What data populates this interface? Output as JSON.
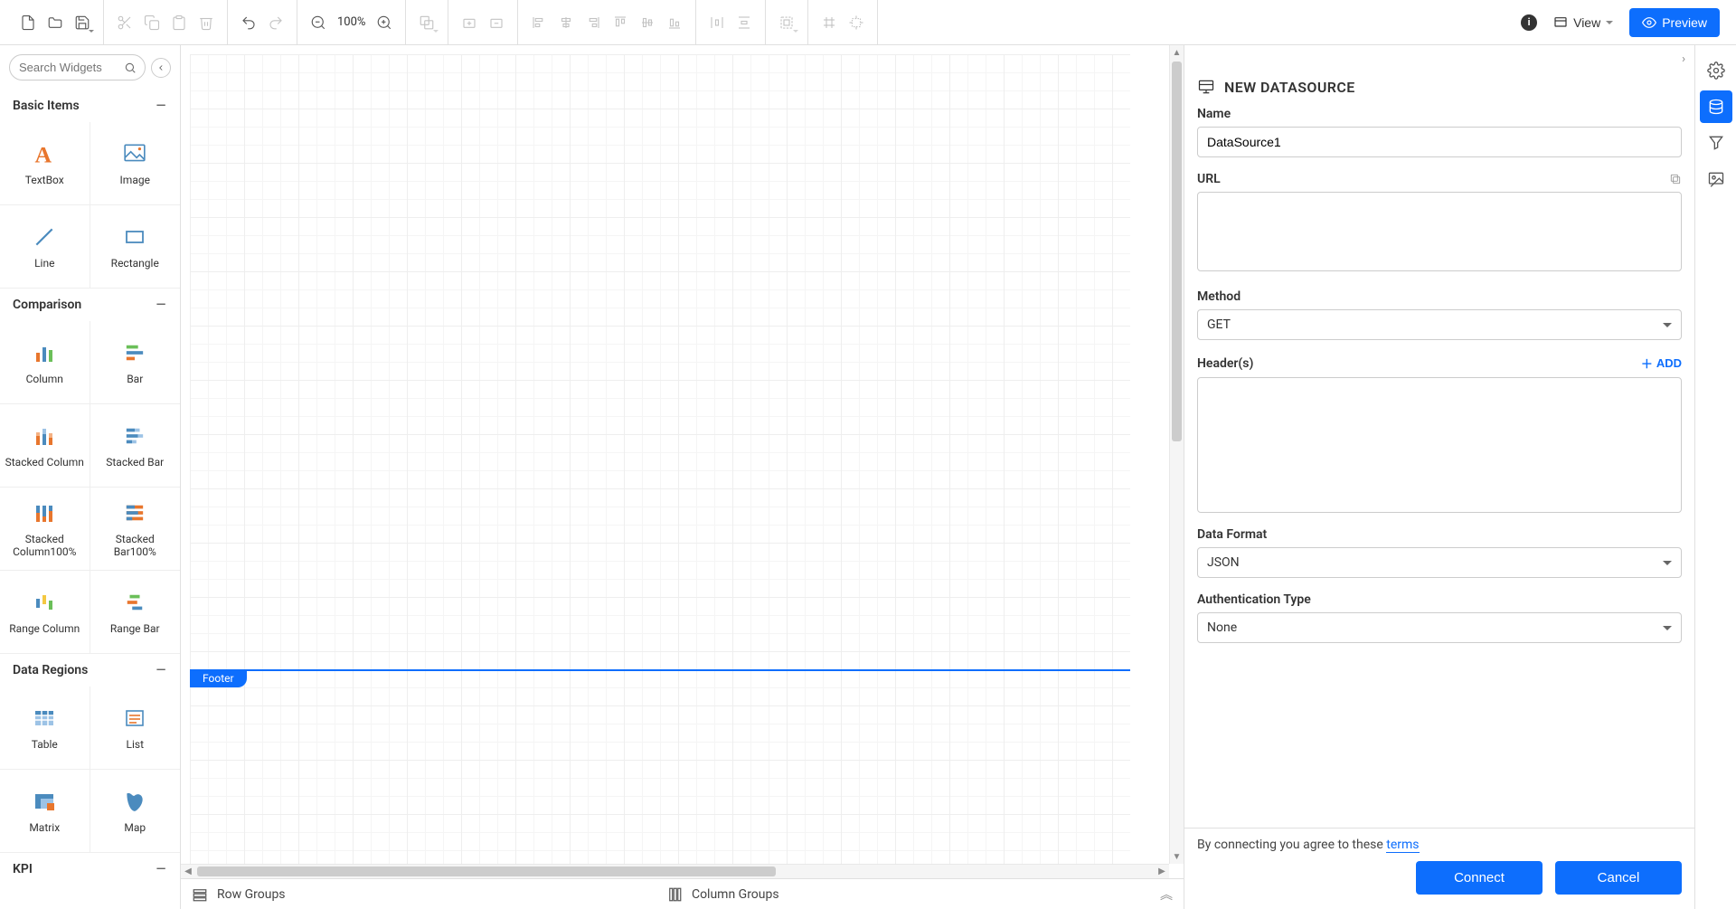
{
  "toolbar": {
    "zoom": "100%",
    "view_label": "View",
    "preview_label": "Preview"
  },
  "search": {
    "placeholder": "Search Widgets"
  },
  "sections": {
    "basic": {
      "title": "Basic Items",
      "items": [
        "TextBox",
        "Image",
        "Line",
        "Rectangle"
      ]
    },
    "comparison": {
      "title": "Comparison",
      "items": [
        "Column",
        "Bar",
        "Stacked Column",
        "Stacked Bar",
        "Stacked Column100%",
        "Stacked Bar100%",
        "Range Column",
        "Range Bar"
      ]
    },
    "dataregions": {
      "title": "Data Regions",
      "items": [
        "Table",
        "List",
        "Matrix",
        "Map"
      ]
    },
    "kpi": {
      "title": "KPI"
    }
  },
  "canvas": {
    "footer_label": "Footer"
  },
  "groups": {
    "row": "Row Groups",
    "column": "Column Groups"
  },
  "panel": {
    "title": "NEW DATASOURCE",
    "name_label": "Name",
    "name_value": "DataSource1",
    "url_label": "URL",
    "url_value": "",
    "method_label": "Method",
    "method_value": "GET",
    "headers_label": "Header(s)",
    "add_label": "ADD",
    "dataformat_label": "Data Format",
    "dataformat_value": "JSON",
    "auth_label": "Authentication Type",
    "auth_value": "None",
    "terms_prefix": "By connecting you agree to these ",
    "terms_link": "terms",
    "connect": "Connect",
    "cancel": "Cancel"
  }
}
